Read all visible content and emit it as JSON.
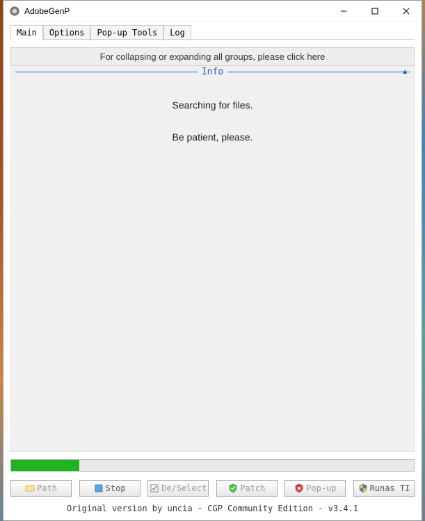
{
  "window": {
    "title": "AdobeGenP"
  },
  "tabs": {
    "main": "Main",
    "options": "Options",
    "popup_tools": "Pop-up Tools",
    "log": "Log"
  },
  "collapse_hint": "For collapsing or expanding all groups, please click here",
  "info": {
    "label": "Info",
    "line1": "Searching for files.",
    "line2": "Be patient, please."
  },
  "buttons": {
    "path": "Path",
    "stop": "Stop",
    "deselect": "De/Select",
    "patch": "Patch",
    "popup": "Pop-up",
    "runas": "Runas TI"
  },
  "footer": "Original version by uncia - CGP Community Edition - v3.4.1"
}
